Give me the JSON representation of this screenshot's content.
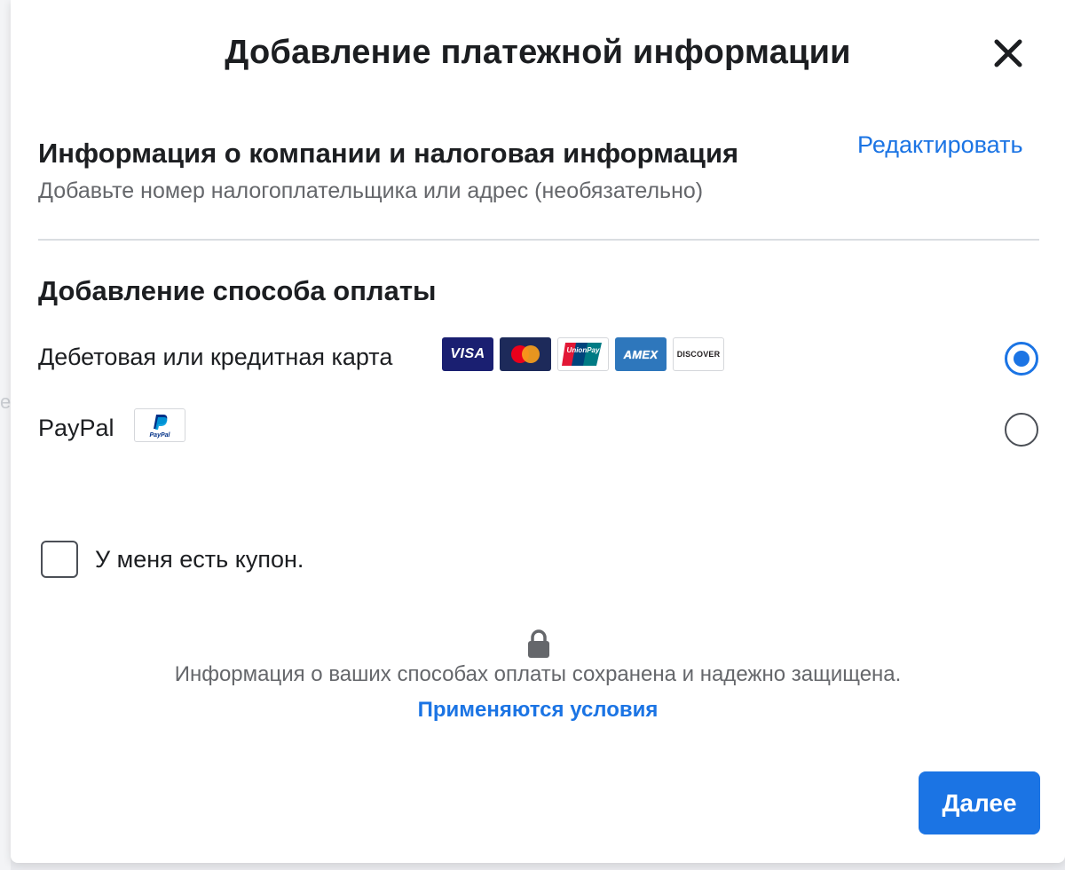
{
  "dialog": {
    "title": "Добавление платежной информации"
  },
  "company_section": {
    "title": "Информация о компании и налоговая информация",
    "subtitle": "Добавьте номер налогоплательщика или адрес (необязательно)",
    "edit_label": "Редактировать"
  },
  "payment_section": {
    "title": "Добавление способа оплаты",
    "options": [
      {
        "label": "Дебетовая или кредитная карта",
        "selected": true,
        "logos": [
          {
            "name": "VISA",
            "icon": "visa-logo-icon"
          },
          {
            "name": "Mastercard",
            "icon": "mastercard-logo-icon"
          },
          {
            "name": "UnionPay",
            "icon": "unionpay-logo-icon"
          },
          {
            "name": "AMEX",
            "icon": "amex-logo-icon"
          },
          {
            "name": "DISCOVER",
            "icon": "discover-logo-icon"
          }
        ]
      },
      {
        "label": "PayPal",
        "selected": false,
        "logos": [
          {
            "name": "PayPal",
            "icon": "paypal-logo-icon"
          }
        ]
      }
    ]
  },
  "coupon": {
    "label": "У меня есть купон.",
    "checked": false
  },
  "footer": {
    "security_note": "Информация о ваших способах оплаты сохранена и надежно защищена.",
    "terms_link": "Применяются условия",
    "icon": "lock-icon"
  },
  "actions": {
    "next_label": "Далее"
  },
  "colors": {
    "accent": "#1b74e4",
    "text_primary": "#1c1e21",
    "text_secondary": "#65676b",
    "visa_blue": "#1a1f71",
    "mastercard_navy": "#1d2a5a",
    "amex_blue": "#2e77bc"
  }
}
